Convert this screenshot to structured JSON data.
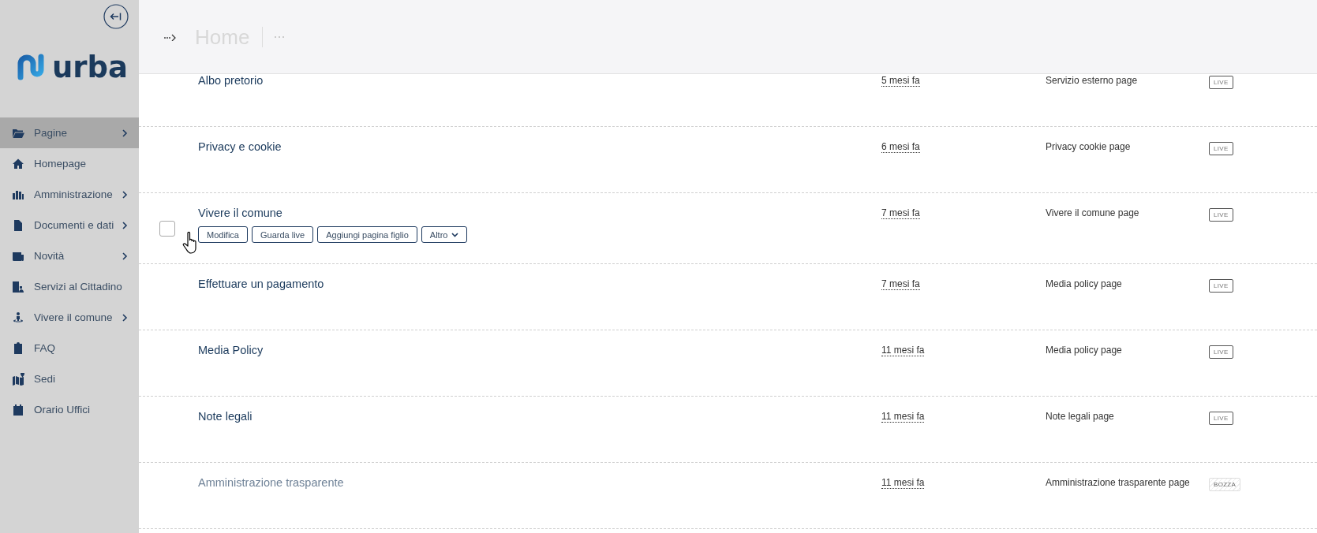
{
  "sidebar": {
    "logo": "urba",
    "menu": [
      {
        "label": "Pagine",
        "has_submenu": true,
        "selected": true
      },
      {
        "label": "Homepage",
        "has_submenu": false,
        "selected": false
      },
      {
        "label": "Amministrazione",
        "has_submenu": true,
        "selected": false
      },
      {
        "label": "Documenti e dati",
        "has_submenu": true,
        "selected": false
      },
      {
        "label": "Novità",
        "has_submenu": true,
        "selected": false
      },
      {
        "label": "Servizi al Cittadino",
        "has_submenu": false,
        "selected": false
      },
      {
        "label": "Vivere il comune",
        "has_submenu": true,
        "selected": false
      },
      {
        "label": "FAQ",
        "has_submenu": false,
        "selected": false
      },
      {
        "label": "Sedi",
        "has_submenu": false,
        "selected": false
      },
      {
        "label": "Orario Uffici",
        "has_submenu": false,
        "selected": false
      }
    ]
  },
  "header": {
    "title": "Home"
  },
  "rows": [
    {
      "title": "Albo pretorio",
      "date": "5 mesi fa",
      "type": "Servizio esterno page",
      "status": {
        "label": "LIVE",
        "kind": "live"
      }
    },
    {
      "title": "Privacy e cookie",
      "date": "6 mesi fa",
      "type": "Privacy cookie page",
      "status": {
        "label": "LIVE",
        "kind": "live"
      }
    },
    {
      "title": "Vivere il comune",
      "date": "7 mesi fa",
      "type": "Vivere il comune page",
      "status": {
        "label": "LIVE",
        "kind": "live"
      },
      "checkbox": {
        "checked": false
      },
      "actions": [
        {
          "label": "Modifica",
          "kind": "button"
        },
        {
          "label": "Guarda live",
          "kind": "button"
        },
        {
          "label": "Aggiungi pagina figlio",
          "kind": "button"
        },
        {
          "label": "Altro",
          "kind": "dropdown"
        }
      ]
    },
    {
      "title": "Effettuare un pagamento",
      "date": "7 mesi fa",
      "type": "Media policy page",
      "status": {
        "label": "LIVE",
        "kind": "live"
      }
    },
    {
      "title": "Media Policy",
      "date": "11 mesi fa",
      "type": "Media policy page",
      "status": {
        "label": "LIVE",
        "kind": "live"
      }
    },
    {
      "title": "Note legali",
      "date": "11 mesi fa",
      "type": "Note legali page",
      "status": {
        "label": "LIVE",
        "kind": "live"
      }
    },
    {
      "title": "Amministrazione trasparente",
      "date": "11 mesi fa",
      "type": "Amministrazione trasparente page",
      "status": {
        "label": "BOZZA",
        "kind": "draft"
      }
    }
  ]
}
